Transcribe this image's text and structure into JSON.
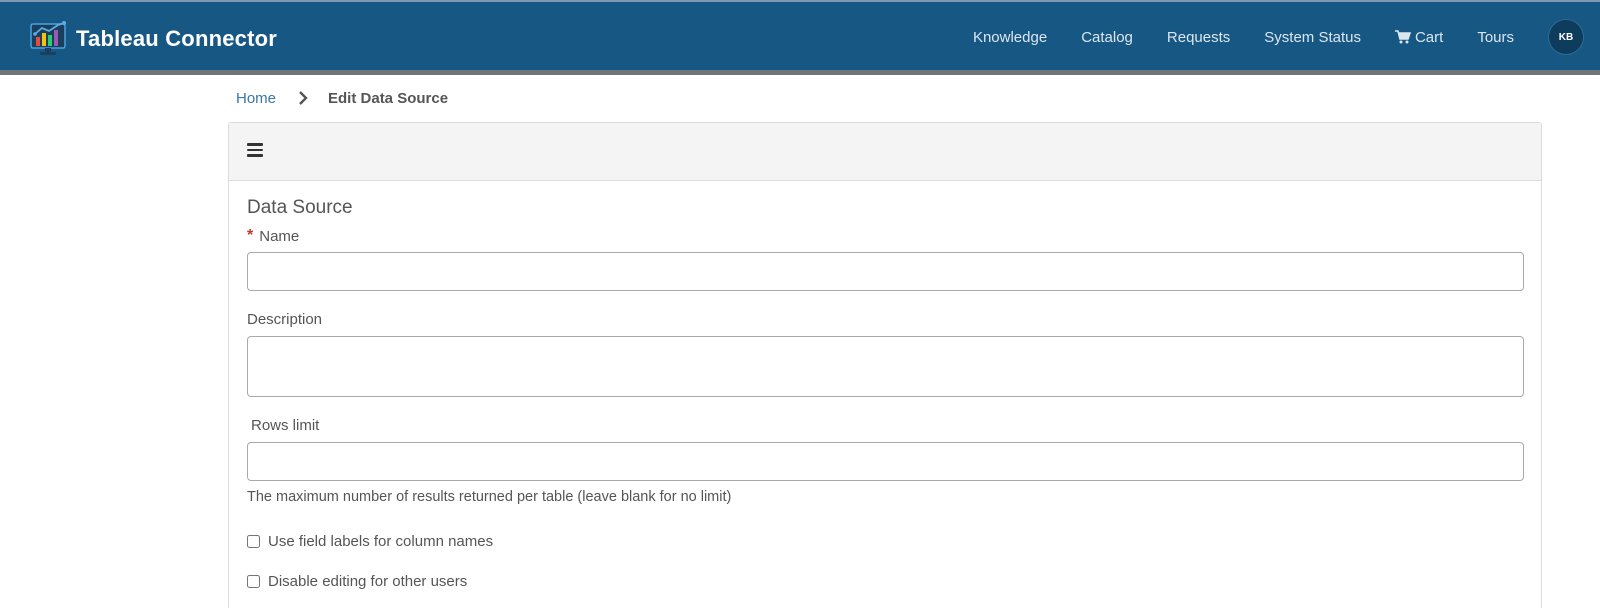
{
  "app": {
    "title": "Tableau Connector",
    "logo_icon": "tableau-chart-logo-icon"
  },
  "nav": {
    "items": [
      {
        "label": "Knowledge"
      },
      {
        "label": "Catalog"
      },
      {
        "label": "Requests"
      },
      {
        "label": "System Status"
      },
      {
        "label": "Cart",
        "icon": "cart-icon"
      },
      {
        "label": "Tours"
      }
    ],
    "avatar_initials": "KB"
  },
  "breadcrumb": {
    "home": "Home",
    "current": "Edit Data Source"
  },
  "form": {
    "section_title": "Data Source",
    "name_label": "Name",
    "name_required_marker": "*",
    "name_value": "",
    "description_label": "Description",
    "description_value": "",
    "rows_limit_label": "Rows limit",
    "rows_limit_value": "",
    "rows_limit_help": "The maximum number of results returned per table (leave blank for no limit)",
    "checkbox_field_labels": {
      "label": "Use field labels for column names",
      "checked": false
    },
    "checkbox_disable_editing": {
      "label": "Disable editing for other users",
      "checked": false
    }
  },
  "colors": {
    "header_bg": "#175783",
    "link": "#3a76a8",
    "required": "#c0392b"
  }
}
